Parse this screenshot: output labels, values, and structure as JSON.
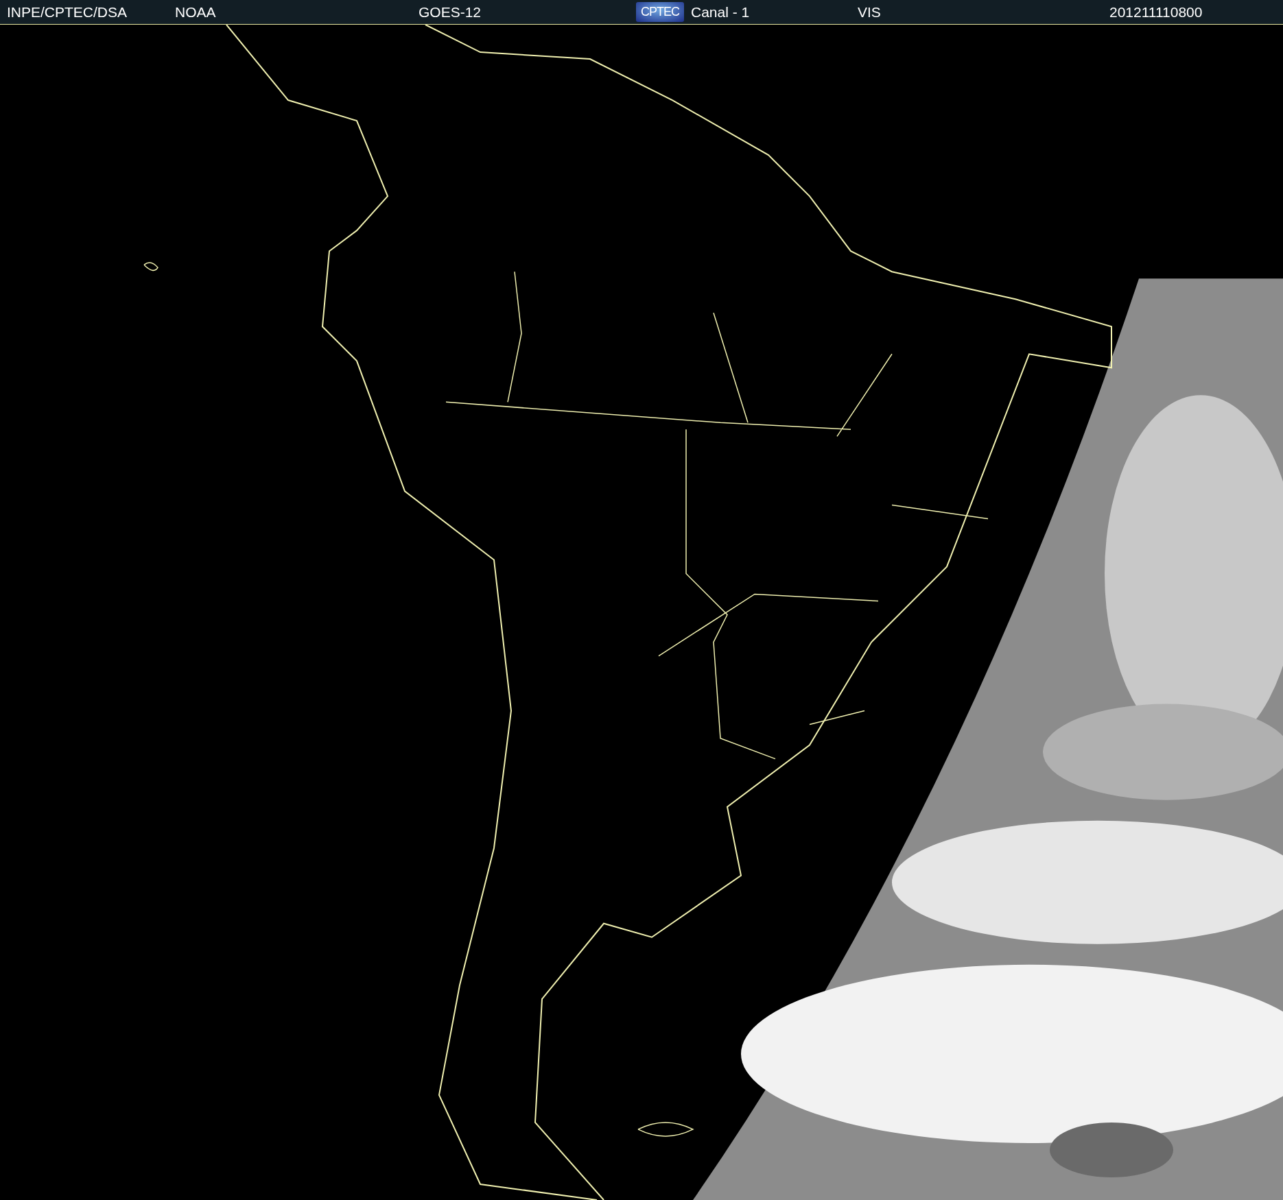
{
  "header": {
    "items": [
      {
        "kind": "text",
        "text": "INPE/CPTEC/DSA"
      },
      {
        "kind": "text",
        "text": "NOAA"
      },
      {
        "kind": "text",
        "text": "GOES-12"
      },
      {
        "kind": "logo",
        "text": "CPTEC"
      },
      {
        "kind": "text",
        "text": "Canal - 1"
      },
      {
        "kind": "text",
        "text": "VIS"
      },
      {
        "kind": "text",
        "text": "201211110800"
      }
    ]
  }
}
